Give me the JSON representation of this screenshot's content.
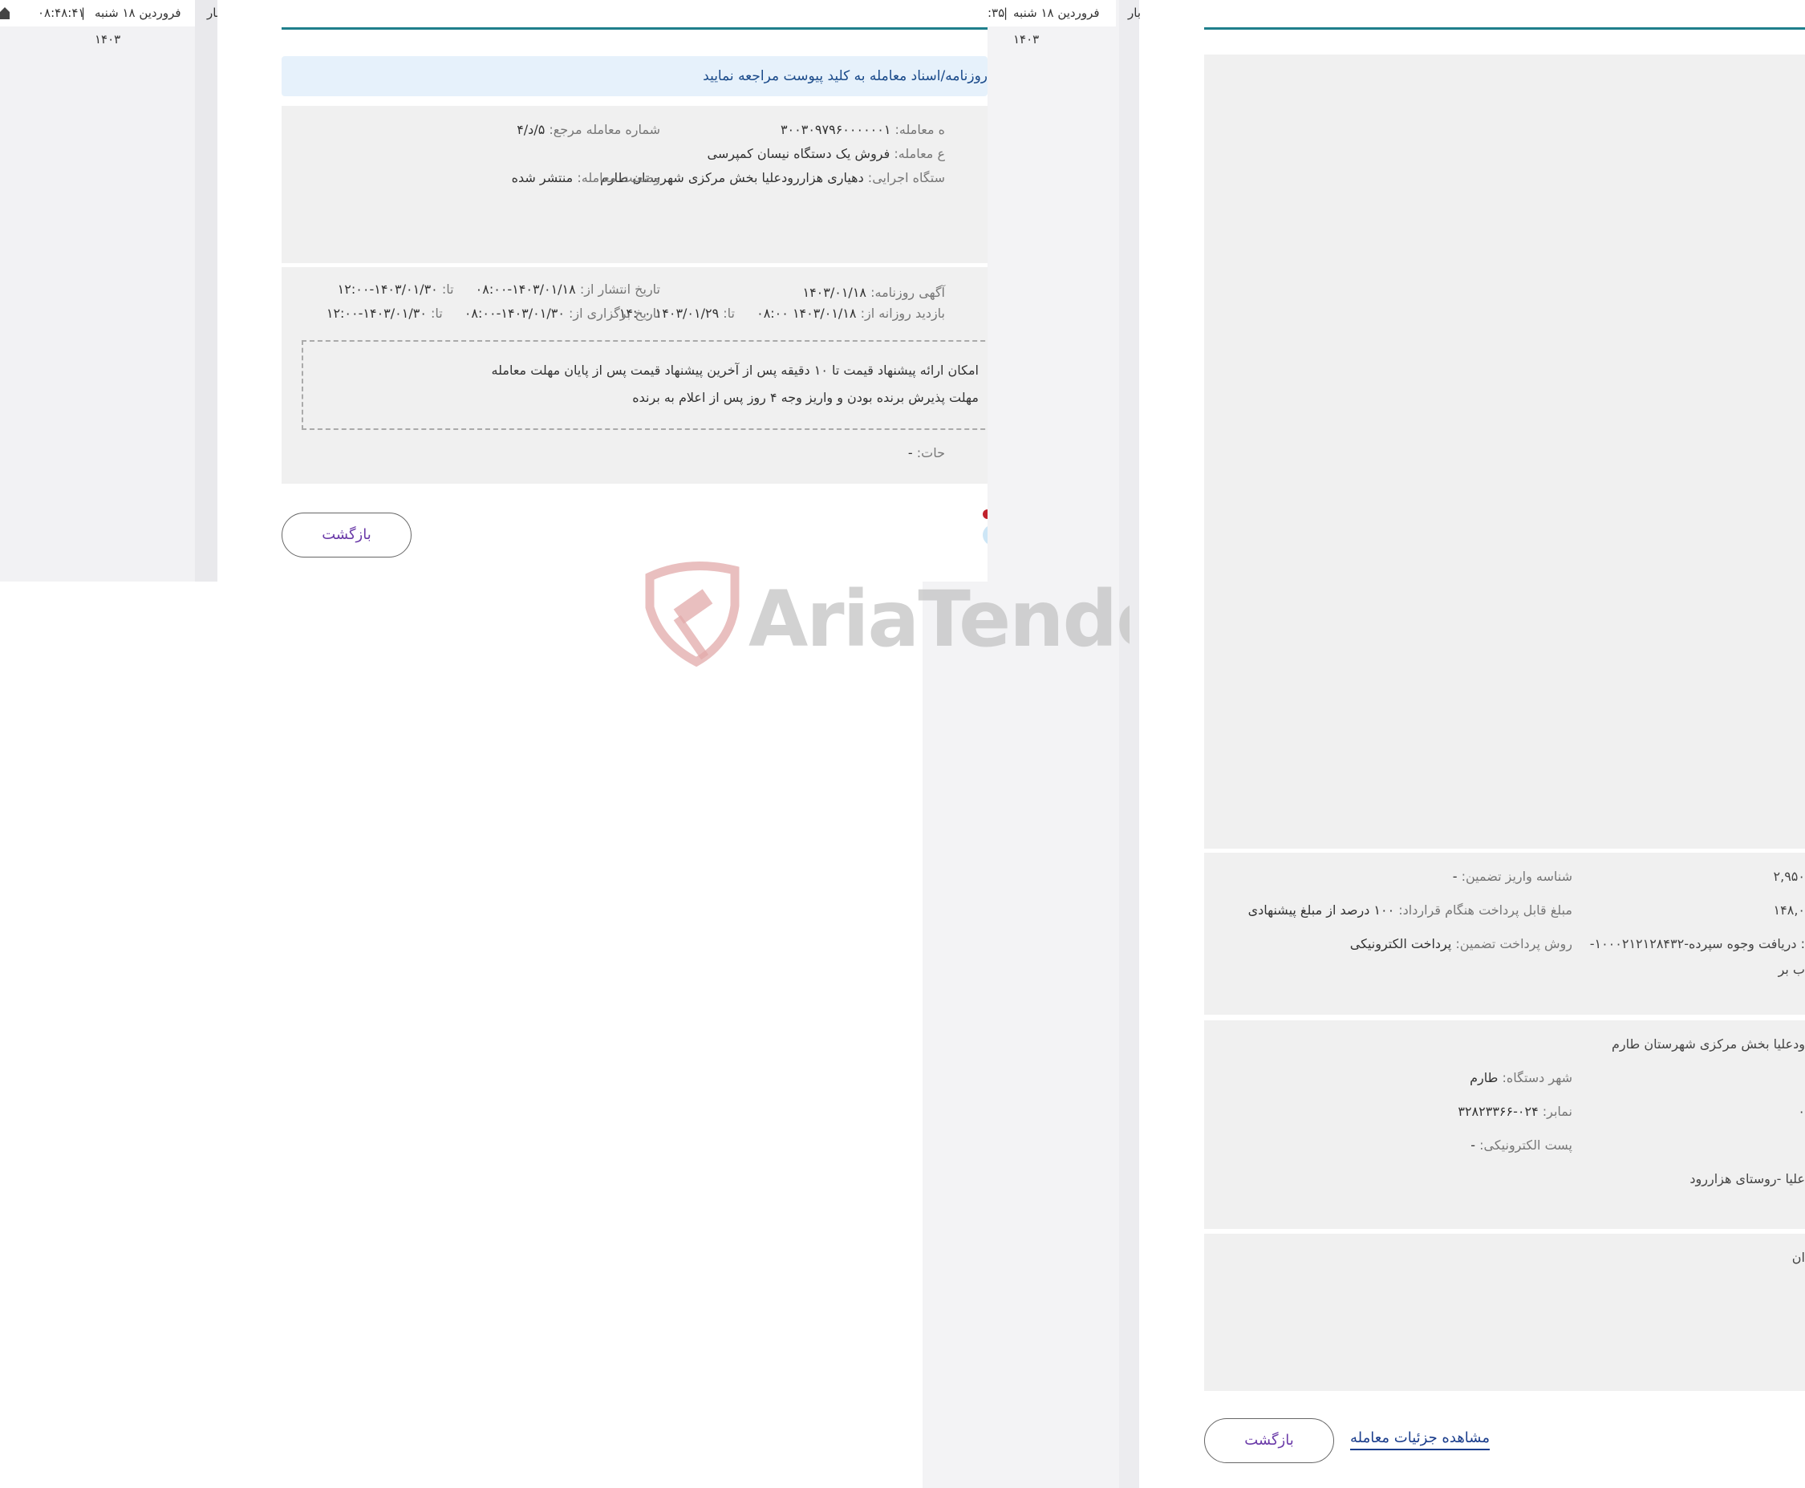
{
  "left_fragment": {
    "time": "۰۸:۴۸:۴۱",
    "separator": "|",
    "date": "فروردین ۱۸ شنبه ۱۴۰۳",
    "cut_label": "بار"
  },
  "panel1": {
    "topbar": {
      "date": "فروردین ۱۸ شنبه ۱۴۰۳",
      "separator": "|",
      "time_fragment": ":۳۵",
      "cut_label": "بار"
    },
    "notice": "روزنامه/اسناد معامله به کلید پیوست مراجعه نمایید",
    "info": {
      "deal_number_label": "ه معامله:",
      "deal_number": "۳۰۰۳۰۹۷۹۶۰۰۰۰۰۰۱",
      "ref_number_label": "شماره معامله مرجع:",
      "ref_number": "۵/د/۴",
      "subject_label": "ع معامله:",
      "subject": "فروش یک دستگاه نیسان کمپرسی",
      "agency_label": "ستگاه اجرایی:",
      "agency": "دهیاری هزاررودعلیا بخش مرکزی شهرستان طارم",
      "status_label": "وضعیت معامله:",
      "status": "منتشر شده"
    },
    "dates": {
      "ad_label": "آگهی روزنامه:",
      "ad_date": "۱۴۰۳/۰۱/۱۸",
      "publish_label": "تاریخ انتشار از:",
      "publish_from": "۱۴۰۳/۰۱/۱۸-۰۸:۰۰",
      "to_label": "تا:",
      "publish_to": "۱۴۰۳/۰۱/۳۰-۱۲:۰۰",
      "visit_label": "بازدید روزانه از:",
      "visit_from": "۱۴۰۳/۰۱/۱۸ ۰۸:۰۰",
      "visit_to": "۱۴۰۳/۰۱/۲۹ ۱۴:۰۰",
      "hold_label": "تاریخ برگزاری از:",
      "hold_from": "۱۴۰۳/۰۱/۳۰-۰۸:۰۰",
      "hold_to": "۱۴۰۳/۰۱/۳۰-۱۲:۰۰"
    },
    "conditions": [
      "امکان ارائه پیشنهاد قیمت تا ۱۰ دقیقه پس از آخرین پیشنهاد قیمت پس از پایان مهلت معامله",
      "مهلت پذیرش برنده بودن و واریز وجه ۴ روز پس از اعلام به برنده"
    ],
    "notes_label": "حات:",
    "notes_value": "-",
    "back_button": "بازگشت"
  },
  "panel2": {
    "guarantee": {
      "amount_fragment": "۲,۹۵۰",
      "id_label": "شناسه واریز تضمین:",
      "id_value": "-",
      "contract_amount_fragment": "۱۴۸,۰",
      "contract_label": "مبلغ قابل پرداخت هنگام قرارداد:",
      "contract_value": "۱۰۰ درصد از مبلغ پیشنهادی",
      "account_fragment": ": دریافت وجوه سپرده-۱۰۰۰۲۱۲۱۲۸۴۳۲-",
      "account_fragment2": "ب بر",
      "method_label": "روش پرداخت تضمین:",
      "method_value": "پرداخت الکترونیکی"
    },
    "agency": {
      "name_fragment": "ودعلیا بخش مرکزی شهرستان طارم",
      "city_label": "شهر دستگاه:",
      "city_value": "طارم",
      "fax_label": "نمابر:",
      "fax_value": "۰۲۴-۳۲۸۲۳۳۶۶",
      "phone_fragment": "۰",
      "email_label": "پست الکترونیکی:",
      "email_value": "-",
      "address_fragment": "علیا -روستای هزاررود"
    },
    "section3_fragment": "ان",
    "details_link": "مشاهده جزئیات معامله",
    "back_button": "بازگشت"
  },
  "watermark": "AriaTender.neT",
  "colors": {
    "accent_line": "#1f7f8c",
    "notice_bg": "#e6f1fb",
    "notice_text": "#1a4a8a",
    "box_bg": "#f0f0f0",
    "button_text": "#6a3aa8",
    "link": "#1a3d8c"
  }
}
